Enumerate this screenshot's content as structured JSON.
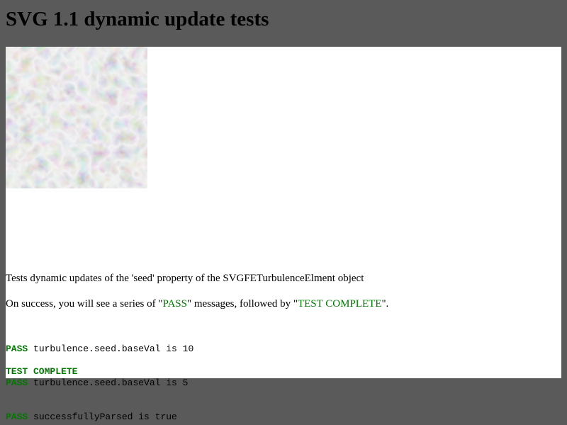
{
  "page": {
    "title": "SVG 1.1 dynamic update tests",
    "background_color": "#5a5a5a",
    "content_background": "#ffffff"
  },
  "graphic": {
    "name": "feTurbulence noise filter render"
  },
  "description": "Tests dynamic updates of the 'seed' property of the SVGFETurbulenceElment object",
  "instructions": {
    "prefix": "On success, you will see a series of \"",
    "pass_word": "PASS",
    "middle": "\" messages, followed by \"",
    "complete_word": "TEST COMPLETE",
    "suffix": "\"."
  },
  "log": [
    {
      "status": "PASS",
      "message": " turbulence.seed.baseVal is 10"
    },
    {
      "status": "PASS",
      "message": " turbulence.seed.baseVal is 5"
    },
    {
      "status": "PASS",
      "message": " successfullyParsed is true"
    }
  ],
  "complete_text": "TEST COMPLETE",
  "colors": {
    "pass": "#007700"
  }
}
